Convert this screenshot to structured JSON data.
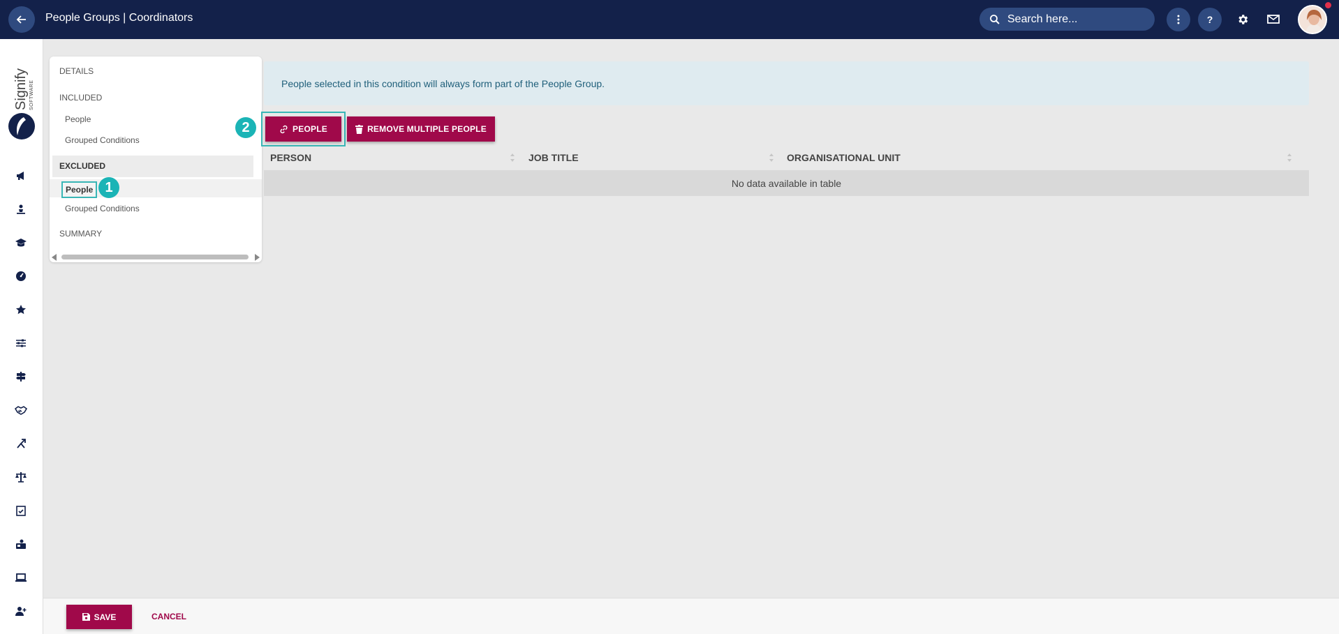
{
  "header": {
    "title": "People Groups | Coordinators",
    "search_placeholder": "Search here...",
    "help_label": "?"
  },
  "brand": {
    "name": "Signify",
    "tagline": "SOFTWARE"
  },
  "subnav": {
    "details": "DETAILS",
    "included": "INCLUDED",
    "included_people": "People",
    "included_grouped": "Grouped Conditions",
    "excluded": "EXCLUDED",
    "excluded_people": "People",
    "excluded_grouped": "Grouped Conditions",
    "summary": "SUMMARY"
  },
  "badges": {
    "one": "1",
    "two": "2"
  },
  "main": {
    "info_text": "People selected in this condition will always form part of the People Group.",
    "people_button": "PEOPLE",
    "remove_button": "REMOVE MULTIPLE PEOPLE",
    "columns": [
      "PERSON",
      "JOB TITLE",
      "ORGANISATIONAL UNIT"
    ],
    "empty_text": "No data available in table"
  },
  "footer": {
    "save": "SAVE",
    "cancel": "CANCEL"
  },
  "colors": {
    "topbar": "#13214a",
    "accent": "#a0094a",
    "highlight": "#1bb4b6"
  }
}
